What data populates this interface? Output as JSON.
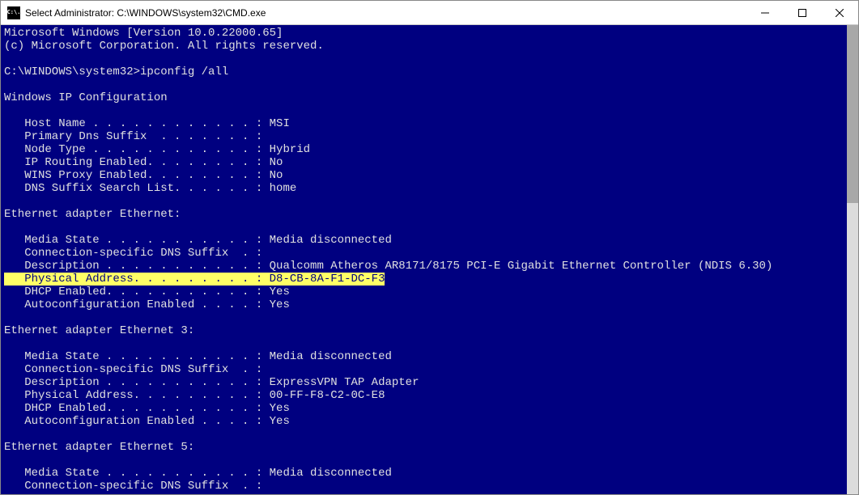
{
  "titlebar": {
    "icon_label": "C:\\.",
    "title": "Select Administrator: C:\\WINDOWS\\system32\\CMD.exe"
  },
  "terminal": {
    "line_version": "Microsoft Windows [Version 10.0.22000.65]",
    "line_copyright": "(c) Microsoft Corporation. All rights reserved.",
    "prompt_prefix": "C:\\WINDOWS\\system32>",
    "prompt_command": "ipconfig /all",
    "section_ipconfig": "Windows IP Configuration",
    "cfg_host": "   Host Name . . . . . . . . . . . . : MSI",
    "cfg_dnssfx": "   Primary Dns Suffix  . . . . . . . :",
    "cfg_node": "   Node Type . . . . . . . . . . . . : Hybrid",
    "cfg_iprt": "   IP Routing Enabled. . . . . . . . : No",
    "cfg_wins": "   WINS Proxy Enabled. . . . . . . . : No",
    "cfg_search": "   DNS Suffix Search List. . . . . . : home",
    "adapter1_title": "Ethernet adapter Ethernet:",
    "a1_media": "   Media State . . . . . . . . . . . : Media disconnected",
    "a1_conn": "   Connection-specific DNS Suffix  . :",
    "a1_desc": "   Description . . . . . . . . . . . : Qualcomm Atheros AR8171/8175 PCI-E Gigabit Ethernet Controller (NDIS 6.30)",
    "a1_phy": "   Physical Address. . . . . . . . . : D8-CB-8A-F1-DC-F3",
    "a1_dhcp": "   DHCP Enabled. . . . . . . . . . . : Yes",
    "a1_auto": "   Autoconfiguration Enabled . . . . : Yes",
    "adapter3_title": "Ethernet adapter Ethernet 3:",
    "a3_media": "   Media State . . . . . . . . . . . : Media disconnected",
    "a3_conn": "   Connection-specific DNS Suffix  . :",
    "a3_desc": "   Description . . . . . . . . . . . : ExpressVPN TAP Adapter",
    "a3_phy": "   Physical Address. . . . . . . . . : 00-FF-F8-C2-0C-E8",
    "a3_dhcp": "   DHCP Enabled. . . . . . . . . . . : Yes",
    "a3_auto": "   Autoconfiguration Enabled . . . . : Yes",
    "adapter5_title": "Ethernet adapter Ethernet 5:",
    "a5_media": "   Media State . . . . . . . . . . . : Media disconnected",
    "a5_conn": "   Connection-specific DNS Suffix  . :"
  }
}
